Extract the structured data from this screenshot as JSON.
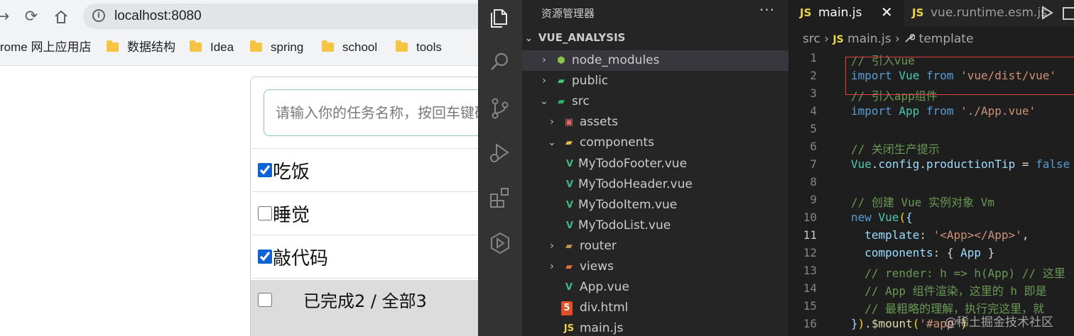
{
  "browser": {
    "url": "localhost:8080",
    "bookmarks": [
      {
        "label": "rome 网上应用店",
        "folder": false
      },
      {
        "label": "数据结构",
        "folder": true
      },
      {
        "label": "Idea",
        "folder": true
      },
      {
        "label": "spring",
        "folder": true
      },
      {
        "label": "school",
        "folder": true
      },
      {
        "label": "tools",
        "folder": true
      }
    ],
    "todo": {
      "input_placeholder": "请输入你的任务名称，按回车键确认",
      "items": [
        {
          "label": "吃饭",
          "done": true
        },
        {
          "label": "睡觉",
          "done": false
        },
        {
          "label": "敲代码",
          "done": true
        }
      ],
      "footer_text": "已完成2 / 全部3"
    }
  },
  "explorer": {
    "title": "资源管理器",
    "more": "···",
    "project": "VUE_ANALYSIS",
    "tree": [
      {
        "label": "node_modules",
        "icon": "node-folder-icon",
        "depth": 0,
        "chevron": "›",
        "selected": true
      },
      {
        "label": "public",
        "icon": "public-folder-icon",
        "depth": 0,
        "chevron": "›"
      },
      {
        "label": "src",
        "icon": "src-folder-icon",
        "depth": 0,
        "chevron": "⌄"
      },
      {
        "label": "assets",
        "icon": "assets-folder-icon",
        "depth": 1,
        "chevron": "›"
      },
      {
        "label": "components",
        "icon": "components-folder-icon",
        "depth": 1,
        "chevron": "⌄"
      },
      {
        "label": "MyTodoFooter.vue",
        "icon": "vue-file-icon",
        "depth": 2
      },
      {
        "label": "MyTodoHeader.vue",
        "icon": "vue-file-icon",
        "depth": 2
      },
      {
        "label": "MyTodoItem.vue",
        "icon": "vue-file-icon",
        "depth": 2
      },
      {
        "label": "MyTodoList.vue",
        "icon": "vue-file-icon",
        "depth": 2
      },
      {
        "label": "router",
        "icon": "folder-icon",
        "depth": 1,
        "chevron": "›"
      },
      {
        "label": "views",
        "icon": "views-folder-icon",
        "depth": 1,
        "chevron": "›"
      },
      {
        "label": "App.vue",
        "icon": "vue-file-icon",
        "depth": 1
      },
      {
        "label": "div.html",
        "icon": "html-file-icon",
        "depth": 1
      },
      {
        "label": "main.js",
        "icon": "js-file-icon",
        "depth": 1
      }
    ]
  },
  "editor": {
    "tabs": [
      {
        "icon": "JS",
        "label": "main.js",
        "close": "✕"
      },
      {
        "icon": "JS",
        "label": "vue.runtime.esm.js"
      }
    ],
    "breadcrumbs": {
      "part1": "src",
      "sep": "›",
      "js": "JS",
      "part2": "main.js",
      "part3": "template"
    },
    "current_line": 11,
    "lines": [
      {
        "n": "1",
        "tokens": [
          {
            "t": "// 引入vue",
            "c": "c-com"
          }
        ]
      },
      {
        "n": "2",
        "tokens": [
          {
            "t": "import",
            "c": "c-kw"
          },
          {
            "t": " Vue ",
            "c": "c-id"
          },
          {
            "t": "from",
            "c": "c-kw"
          },
          {
            "t": " 'vue/dist/vue'",
            "c": "c-str"
          }
        ]
      },
      {
        "n": "3",
        "tokens": [
          {
            "t": "// 引入app组件",
            "c": "c-com"
          }
        ]
      },
      {
        "n": "4",
        "tokens": [
          {
            "t": "import",
            "c": "c-kw"
          },
          {
            "t": " App ",
            "c": "c-id"
          },
          {
            "t": "from",
            "c": "c-kw"
          },
          {
            "t": " './App.vue'",
            "c": "c-str"
          }
        ]
      },
      {
        "n": "5",
        "tokens": []
      },
      {
        "n": "6",
        "tokens": [
          {
            "t": "// 关闭生产提示",
            "c": "c-com"
          }
        ]
      },
      {
        "n": "7",
        "tokens": [
          {
            "t": "Vue",
            "c": "c-id"
          },
          {
            "t": ".",
            "c": ""
          },
          {
            "t": "config",
            "c": "c-var"
          },
          {
            "t": ".",
            "c": ""
          },
          {
            "t": "productionTip",
            "c": "c-var"
          },
          {
            "t": " = ",
            "c": ""
          },
          {
            "t": "false",
            "c": "c-kw"
          }
        ]
      },
      {
        "n": "8",
        "tokens": []
      },
      {
        "n": "9",
        "tokens": [
          {
            "t": "// 创建 Vue 实例对象 Vm",
            "c": "c-com"
          }
        ]
      },
      {
        "n": "10",
        "tokens": [
          {
            "t": "new",
            "c": "c-kw"
          },
          {
            "t": " Vue",
            "c": "c-id"
          },
          {
            "t": "(",
            "c": "c-br"
          },
          {
            "t": "{",
            "c": "c-var"
          }
        ]
      },
      {
        "n": "11",
        "tokens": [
          {
            "t": "  template",
            "c": "c-var"
          },
          {
            "t": ": ",
            "c": ""
          },
          {
            "t": "'<App></App>'",
            "c": "c-str"
          },
          {
            "t": ",",
            "c": ""
          }
        ]
      },
      {
        "n": "12",
        "tokens": [
          {
            "t": "  components",
            "c": "c-var"
          },
          {
            "t": ": { ",
            "c": ""
          },
          {
            "t": "App",
            "c": "c-var"
          },
          {
            "t": " }",
            "c": ""
          }
        ]
      },
      {
        "n": "13",
        "tokens": [
          {
            "t": "  // render: h => h(App) // 这里",
            "c": "c-com"
          }
        ]
      },
      {
        "n": "14",
        "tokens": [
          {
            "t": "  // App 组件渲染，这里的 h 即是",
            "c": "c-com"
          }
        ]
      },
      {
        "n": "15",
        "tokens": [
          {
            "t": "  // 最粗略的理解，执行完这里，就",
            "c": "c-com"
          }
        ]
      },
      {
        "n": "16",
        "tokens": [
          {
            "t": "}",
            "c": "c-var"
          },
          {
            "t": ")",
            "c": "c-br"
          },
          {
            "t": ".",
            "c": ""
          },
          {
            "t": "$mount",
            "c": "c-fn"
          },
          {
            "t": "(",
            "c": "c-br"
          },
          {
            "t": "'#app'",
            "c": "c-str"
          },
          {
            "t": ")",
            "c": "c-br"
          }
        ]
      }
    ]
  },
  "watermark": "@稀土掘金技术社区",
  "colors": {
    "vue_green": "#41b883",
    "js_yellow": "#e8d44d",
    "selection": "#37373d"
  }
}
